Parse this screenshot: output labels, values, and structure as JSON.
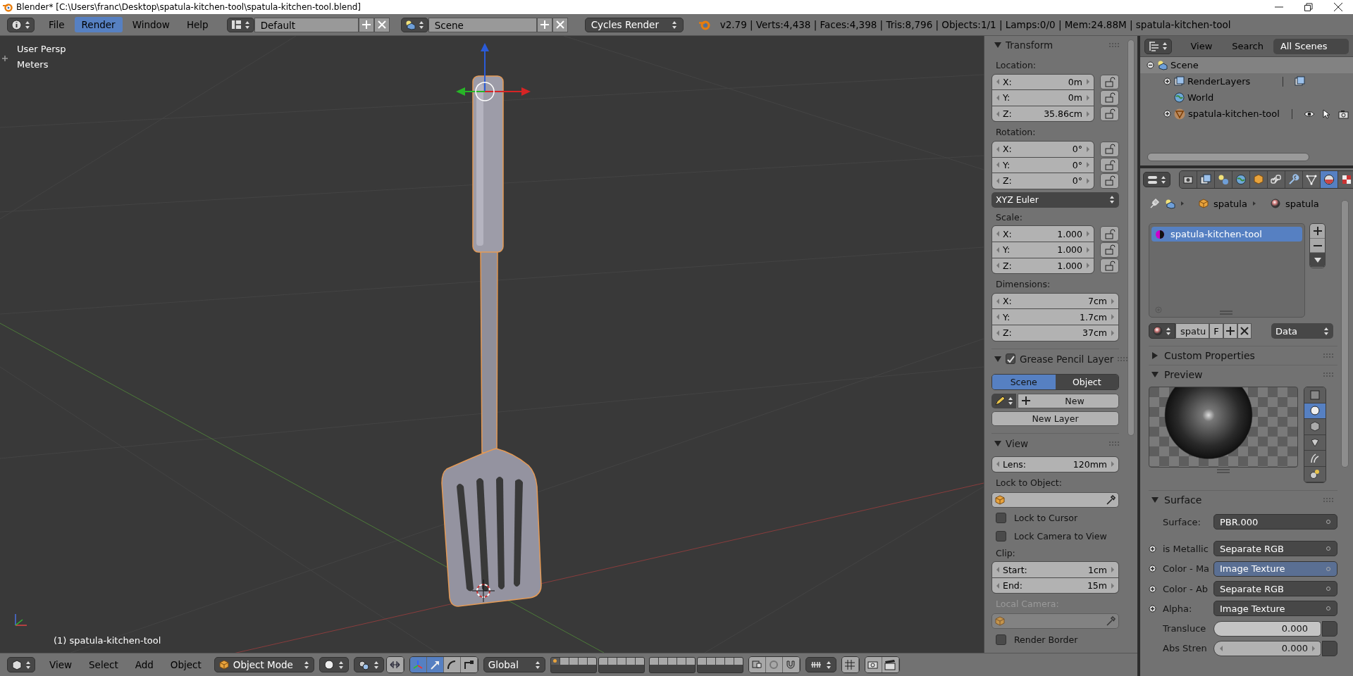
{
  "window": {
    "title": "Blender* [C:\\Users\\franc\\Desktop\\spatula-kitchen-tool\\spatula-kitchen-tool.blend]"
  },
  "info_header": {
    "menus": [
      {
        "label": "File",
        "selected": false
      },
      {
        "label": "Render",
        "selected": true
      },
      {
        "label": "Window",
        "selected": false
      },
      {
        "label": "Help",
        "selected": false
      }
    ],
    "screen_layout": "Default",
    "scene": "Scene",
    "render_engine": "Cycles Render",
    "stats": "v2.79 | Verts:4,438 | Faces:4,398 | Tris:8,796 | Objects:1/1 | Lamps:0/0 | Mem:24.88M | spatula-kitchen-tool"
  },
  "viewport": {
    "view_name": "User Persp",
    "units": "Meters",
    "active_object": "(1) spatula-kitchen-tool"
  },
  "n_panel": {
    "panels": [
      {
        "title": "Transform",
        "expanded": true,
        "items": [
          {
            "kind": "label",
            "text": "Location:",
            "disabled": false
          },
          {
            "kind": "vector",
            "locks": true,
            "fields": [
              {
                "label": "X:",
                "value": "0m"
              },
              {
                "label": "Y:",
                "value": "0m"
              },
              {
                "label": "Z:",
                "value": "35.86cm"
              }
            ]
          },
          {
            "kind": "label",
            "text": "Rotation:",
            "disabled": false
          },
          {
            "kind": "vector",
            "locks": true,
            "fields": [
              {
                "label": "X:",
                "value": "0°"
              },
              {
                "label": "Y:",
                "value": "0°"
              },
              {
                "label": "Z:",
                "value": "0°"
              }
            ]
          },
          {
            "kind": "dropdown",
            "value": "XYZ Euler"
          },
          {
            "kind": "label",
            "text": "Scale:",
            "disabled": false
          },
          {
            "kind": "vector",
            "locks": true,
            "fields": [
              {
                "label": "X:",
                "value": "1.000"
              },
              {
                "label": "Y:",
                "value": "1.000"
              },
              {
                "label": "Z:",
                "value": "1.000"
              }
            ]
          },
          {
            "kind": "label",
            "text": "Dimensions:",
            "disabled": false
          },
          {
            "kind": "vector",
            "locks": false,
            "fields": [
              {
                "label": "X:",
                "value": "7cm"
              },
              {
                "label": "Y:",
                "value": "1.7cm"
              },
              {
                "label": "Z:",
                "value": "37cm"
              }
            ]
          }
        ]
      },
      {
        "title": "Grease Pencil Layer",
        "expanded": true,
        "checked": true,
        "items": [
          {
            "kind": "tabs",
            "tabs": [
              {
                "label": "Scene",
                "selected": true
              },
              {
                "label": "Object",
                "selected": false
              }
            ]
          },
          {
            "kind": "new",
            "label": "New"
          },
          {
            "kind": "button",
            "label": "New Layer"
          }
        ]
      },
      {
        "title": "View",
        "expanded": true,
        "items": [
          {
            "kind": "vector",
            "locks": false,
            "fields": [
              {
                "label": "Lens:",
                "value": "120mm"
              }
            ]
          },
          {
            "kind": "label",
            "text": "Lock to Object:",
            "disabled": false
          },
          {
            "kind": "object-field",
            "disabled": false
          },
          {
            "kind": "checkbox",
            "label": "Lock to Cursor",
            "checked": false
          },
          {
            "kind": "checkbox",
            "label": "Lock Camera to View",
            "checked": false
          },
          {
            "kind": "label",
            "text": "Clip:",
            "disabled": false
          },
          {
            "kind": "vector",
            "locks": false,
            "fields": [
              {
                "label": "Start:",
                "value": "1cm"
              },
              {
                "label": "End:",
                "value": "15m"
              }
            ]
          },
          {
            "kind": "label",
            "text": "Local Camera:",
            "disabled": true
          },
          {
            "kind": "object-field",
            "disabled": true
          },
          {
            "kind": "checkbox",
            "label": "Render Border",
            "checked": false
          }
        ]
      }
    ]
  },
  "outliner": {
    "menus": [
      "View",
      "Search"
    ],
    "filter": "All Scenes",
    "tree": [
      {
        "label": "Scene",
        "kind": "scene",
        "expanded": true,
        "selected": true,
        "children": [
          {
            "label": "RenderLayers",
            "kind": "render-layers",
            "expanded": false,
            "selected": false
          },
          {
            "label": "World",
            "kind": "world",
            "selected": false
          },
          {
            "label": "spatula-kitchen-tool",
            "kind": "mesh-object",
            "expanded": false,
            "selected": false
          }
        ]
      }
    ]
  },
  "properties": {
    "context_tabs": [
      {
        "kind": "render",
        "selected": false
      },
      {
        "kind": "render-layers",
        "selected": false
      },
      {
        "kind": "scene",
        "selected": false
      },
      {
        "kind": "world",
        "selected": false
      },
      {
        "kind": "object",
        "selected": false
      },
      {
        "kind": "constraints",
        "selected": false
      },
      {
        "kind": "modifiers",
        "selected": false
      },
      {
        "kind": "data",
        "selected": false
      },
      {
        "kind": "material",
        "selected": true
      },
      {
        "kind": "texture",
        "selected": false
      }
    ],
    "breadcrumb": [
      "spatula",
      "spatula"
    ],
    "material_slots": [
      {
        "name": "spatula-kitchen-tool",
        "selected": true
      }
    ],
    "datablock": {
      "name": "spatu",
      "fake_user": "F",
      "link": "Data"
    },
    "panels": [
      {
        "title": "Custom Properties",
        "expanded": false,
        "kind": "empty"
      },
      {
        "title": "Preview",
        "expanded": true,
        "kind": "preview",
        "preview_types": [
          {
            "kind": "flat",
            "selected": false
          },
          {
            "kind": "sphere",
            "selected": true
          },
          {
            "kind": "cube",
            "selected": false
          },
          {
            "kind": "monkey",
            "selected": false
          },
          {
            "kind": "hair",
            "selected": false
          },
          {
            "kind": "sky",
            "selected": false
          }
        ]
      },
      {
        "title": "Surface",
        "expanded": true,
        "kind": "surface",
        "rows": [
          {
            "kind": "link",
            "label": "Surface:",
            "value": "PBR.000",
            "highlighted": false
          },
          {
            "kind": "link",
            "label": "is Metallic",
            "value": "Separate RGB",
            "expanded": false,
            "highlighted": false
          },
          {
            "kind": "link",
            "label": "Color - Ma",
            "value": "Image Texture",
            "expanded": false,
            "highlighted": true
          },
          {
            "kind": "link",
            "label": "Color - Ab",
            "value": "Separate RGB",
            "expanded": false,
            "highlighted": false
          },
          {
            "kind": "link",
            "label": "Alpha:",
            "value": "Image Texture",
            "expanded": false,
            "highlighted": false
          },
          {
            "kind": "slider",
            "label": "Transluce",
            "value": "0.000"
          },
          {
            "kind": "number",
            "label": "Abs Stren",
            "value": "0.000"
          }
        ]
      }
    ]
  },
  "footer": {
    "menus": [
      "View",
      "Select",
      "Add",
      "Object"
    ],
    "mode": "Object Mode",
    "manipulator_on": true,
    "transform_modes": [
      {
        "kind": "translate",
        "selected": true
      },
      {
        "kind": "rotate",
        "selected": false
      },
      {
        "kind": "scale",
        "selected": false
      }
    ],
    "orientation": "Global",
    "layers": [
      {
        "selected": true,
        "has_objects": true
      },
      {
        "selected": false,
        "has_objects": false
      },
      {
        "selected": false,
        "has_objects": false
      },
      {
        "selected": false,
        "has_objects": false
      },
      {
        "selected": false,
        "has_objects": false
      },
      {
        "selected": false,
        "has_objects": false
      },
      {
        "selected": false,
        "has_objects": false
      },
      {
        "selected": false,
        "has_objects": false
      },
      {
        "selected": false,
        "has_objects": false
      },
      {
        "selected": false,
        "has_objects": false
      },
      {
        "selected": false,
        "has_objects": false
      },
      {
        "selected": false,
        "has_objects": false
      },
      {
        "selected": false,
        "has_objects": false
      },
      {
        "selected": false,
        "has_objects": false
      },
      {
        "selected": false,
        "has_objects": false
      },
      {
        "selected": false,
        "has_objects": false
      },
      {
        "selected": false,
        "has_objects": false
      },
      {
        "selected": false,
        "has_objects": false
      },
      {
        "selected": false,
        "has_objects": false
      },
      {
        "selected": false,
        "has_objects": false
      }
    ]
  }
}
